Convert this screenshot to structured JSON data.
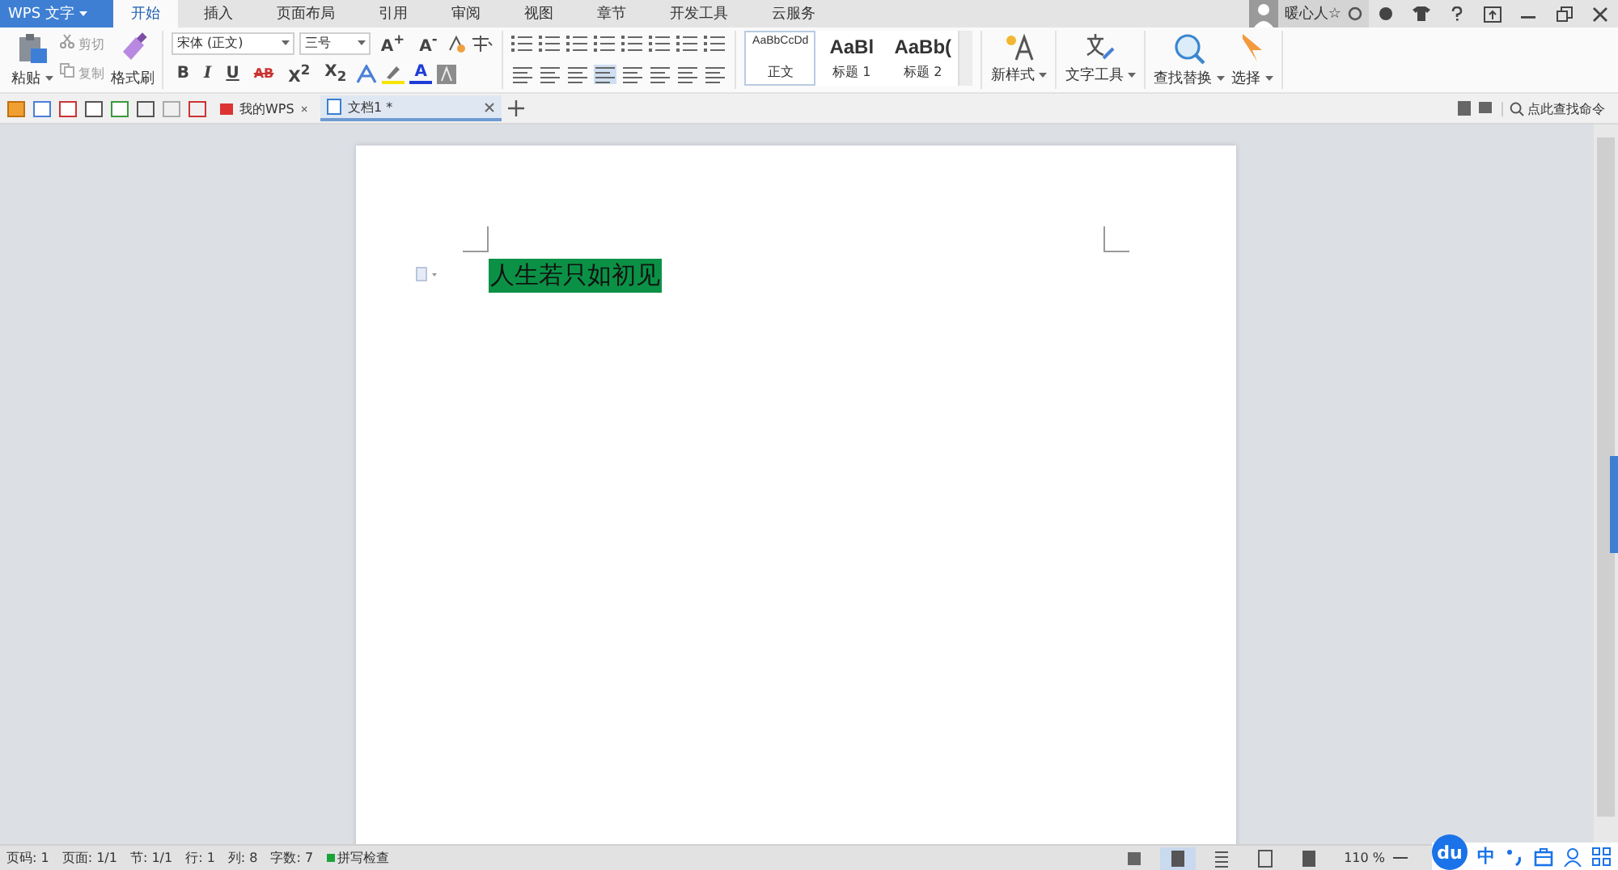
{
  "app_menu": {
    "label": "WPS 文字"
  },
  "ribbon_tabs": [
    {
      "label": "开始",
      "selected": true
    },
    {
      "label": "插入",
      "selected": false
    },
    {
      "label": "页面布局",
      "selected": false
    },
    {
      "label": "引用",
      "selected": false
    },
    {
      "label": "审阅",
      "selected": false
    },
    {
      "label": "视图",
      "selected": false
    },
    {
      "label": "章节",
      "selected": false
    },
    {
      "label": "开发工具",
      "selected": false
    },
    {
      "label": "云服务",
      "selected": false
    }
  ],
  "user": {
    "name": "暖心人☆"
  },
  "ribbon": {
    "clipboard": {
      "paste": "粘贴",
      "cut": "剪切",
      "copy": "复制",
      "format_painter": "格式刷"
    },
    "font": {
      "name": "宋体 (正文)",
      "size": "三号",
      "grow": "A$^{+}$",
      "shrink": "A$^{-}$",
      "buttons": [
        "B",
        "I",
        "U",
        "AB",
        "X$^{2}$",
        "X$_{2}$"
      ],
      "color_letter": "A"
    },
    "styles": [
      {
        "preview": "AaBbCcDd",
        "label": "正文",
        "selected": true,
        "kind": "normal"
      },
      {
        "preview": "AaBl",
        "label": "标题 1",
        "selected": false,
        "kind": "heading"
      },
      {
        "preview": "AaBb(",
        "label": "标题 2",
        "selected": false,
        "kind": "heading"
      }
    ],
    "new_style": "新样式",
    "text_tools": "文字工具",
    "find_replace": "查找替换",
    "select": "选择"
  },
  "doc_tabs": [
    {
      "label": "我的WPS",
      "selected": false
    },
    {
      "label": "文档1 *",
      "selected": true
    }
  ],
  "command_search": {
    "placeholder": "点此查找命令"
  },
  "document": {
    "text": "人生若只如初见"
  },
  "status_bar": {
    "items": [
      "页码: 1",
      "页面: 1/1",
      "节: 1/1",
      "行: 1",
      "列: 8",
      "字数: 7"
    ],
    "spell_check": "拼写检查",
    "zoom": "110 %"
  },
  "ime": {
    "logo": "du",
    "mode": "中"
  }
}
